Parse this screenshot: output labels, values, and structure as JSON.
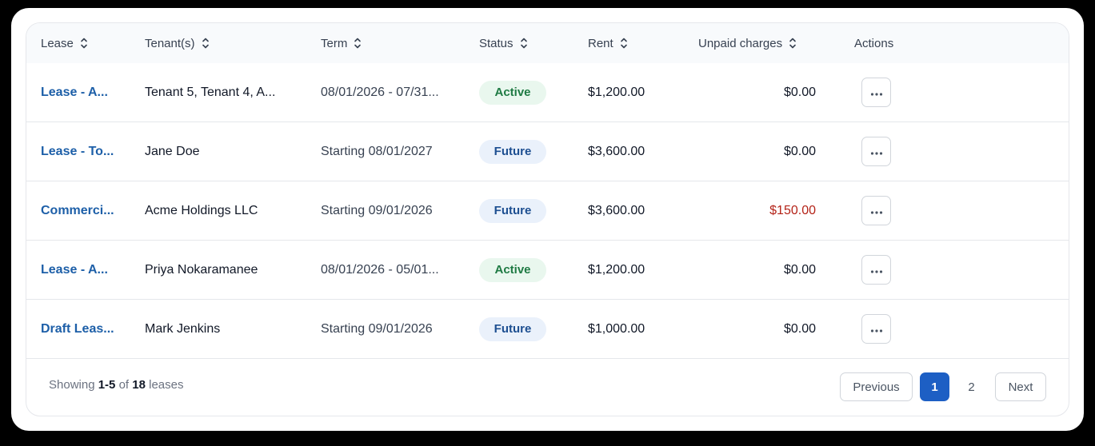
{
  "table": {
    "headers": {
      "lease": "Lease",
      "tenants": "Tenant(s)",
      "term": "Term",
      "status": "Status",
      "rent": "Rent",
      "unpaid": "Unpaid charges",
      "actions": "Actions"
    },
    "rows": [
      {
        "lease": "Lease - A...",
        "tenants": "Tenant 5, Tenant 4, A...",
        "term": "08/01/2026 - 07/31...",
        "status": "Active",
        "rent": "$1,200.00",
        "unpaid": "$0.00"
      },
      {
        "lease": "Lease - To...",
        "tenants": "Jane Doe",
        "term": "Starting 08/01/2027",
        "status": "Future",
        "rent": "$3,600.00",
        "unpaid": "$0.00"
      },
      {
        "lease": "Commerci...",
        "tenants": "Acme Holdings LLC",
        "term": "Starting 09/01/2026",
        "status": "Future",
        "rent": "$3,600.00",
        "unpaid": "$150.00"
      },
      {
        "lease": "Lease - A...",
        "tenants": "Priya Nokaramanee",
        "term": "08/01/2026 - 05/01...",
        "status": "Active",
        "rent": "$1,200.00",
        "unpaid": "$0.00"
      },
      {
        "lease": "Draft Leas...",
        "tenants": "Mark Jenkins",
        "term": "Starting 09/01/2026",
        "status": "Future",
        "rent": "$1,000.00",
        "unpaid": "$0.00"
      }
    ],
    "row_action_icon": "more-horizontal-icon",
    "sort_icon": "sort-updown-icon"
  },
  "footer": {
    "showing_prefix": "Showing",
    "range": "1-5",
    "of": "of",
    "total": "18",
    "suffix": "leases"
  },
  "pagination": {
    "previous": "Previous",
    "pages": [
      "1",
      "2"
    ],
    "current_page": "1",
    "next": "Next"
  },
  "colors": {
    "link": "#1d5fa8",
    "active_bg": "#e9f7ee",
    "active_text": "#1e7a43",
    "future_bg": "#eaf1fb",
    "future_text": "#1d4f91",
    "owed_text": "#b42318",
    "current_page_bg": "#1d5fc4"
  }
}
